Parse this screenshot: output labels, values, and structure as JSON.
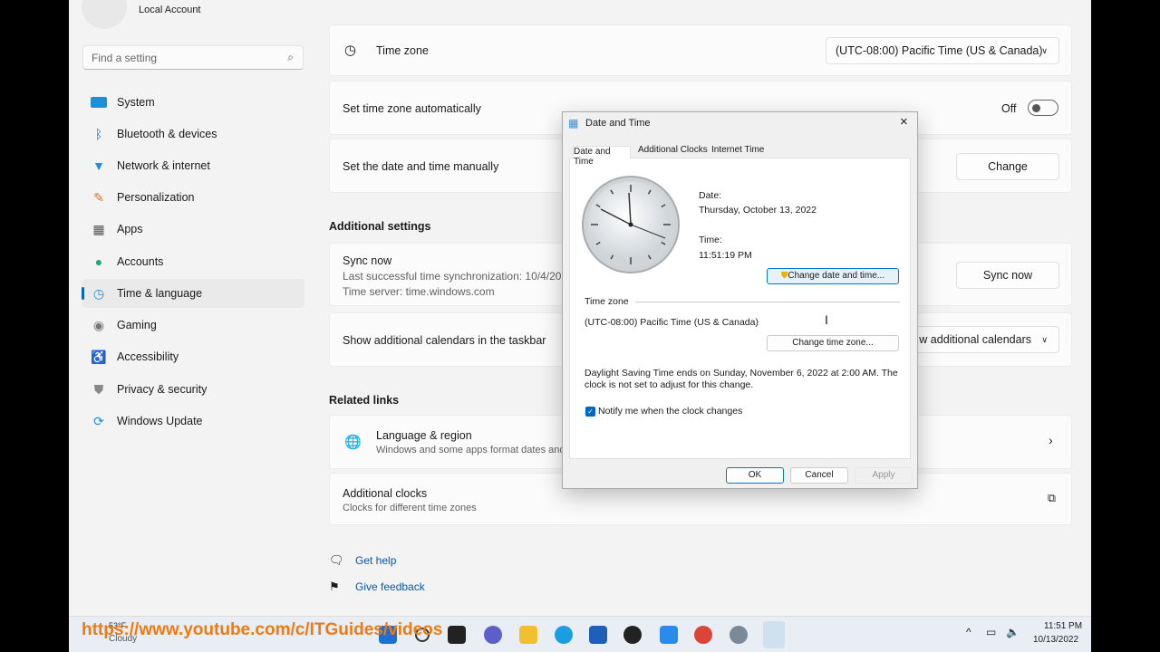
{
  "sidebar": {
    "account": "Local Account",
    "search_placeholder": "Find a setting",
    "items": [
      {
        "label": "System",
        "icon": "system-icon"
      },
      {
        "label": "Bluetooth & devices",
        "icon": "bluetooth-icon"
      },
      {
        "label": "Network & internet",
        "icon": "wifi-icon"
      },
      {
        "label": "Personalization",
        "icon": "brush-icon"
      },
      {
        "label": "Apps",
        "icon": "apps-icon"
      },
      {
        "label": "Accounts",
        "icon": "person-icon"
      },
      {
        "label": "Time & language",
        "icon": "clock-globe-icon",
        "selected": true
      },
      {
        "label": "Gaming",
        "icon": "gamepad-icon"
      },
      {
        "label": "Accessibility",
        "icon": "accessibility-icon"
      },
      {
        "label": "Privacy & security",
        "icon": "shield-icon"
      },
      {
        "label": "Windows Update",
        "icon": "update-icon"
      }
    ]
  },
  "main": {
    "time_zone": {
      "label": "Time zone",
      "value": "(UTC-08:00) Pacific Time (US & Canada)"
    },
    "auto_tz": {
      "label": "Set time zone automatically",
      "state": "Off"
    },
    "manual": {
      "label": "Set the date and time manually",
      "button": "Change"
    },
    "additional_heading": "Additional settings",
    "sync": {
      "title": "Sync now",
      "last": "Last successful time synchronization: 10/4/20",
      "server": "Time server: time.windows.com",
      "button": "Sync now"
    },
    "calendars": {
      "label": "Show additional calendars in the taskbar",
      "value": "w additional calendars"
    },
    "related_heading": "Related links",
    "lang": {
      "title": "Language & region",
      "sub": "Windows and some apps format dates and"
    },
    "clocks": {
      "title": "Additional clocks",
      "sub": "Clocks for different time zones"
    },
    "help": "Get help",
    "feedback": "Give feedback"
  },
  "dialog": {
    "title": "Date and Time",
    "tabs": [
      "Date and Time",
      "Additional Clocks",
      "Internet Time"
    ],
    "date_label": "Date:",
    "date": "Thursday, October 13, 2022",
    "time_label": "Time:",
    "time": "11:51:19 PM",
    "change_dt": "Change date and time...",
    "tz_heading": "Time zone",
    "tz": "(UTC-08:00) Pacific Time (US & Canada)",
    "change_tz": "Change time zone...",
    "dst": "Daylight Saving Time ends on Sunday, November 6, 2022 at 2:00 AM. The clock is not set to adjust for this change.",
    "notify": "Notify me when the clock changes",
    "notify_checked": true,
    "ok": "OK",
    "cancel": "Cancel",
    "apply": "Apply"
  },
  "taskbar": {
    "weather_temp": "53°F",
    "weather": "Cloudy",
    "overlay_url": "https://www.youtube.com/c/ITGuides/videos",
    "time": "11:51 PM",
    "date": "10/13/2022"
  },
  "colors": {
    "accent": "#0067c0",
    "overlay": "#f07a10"
  }
}
